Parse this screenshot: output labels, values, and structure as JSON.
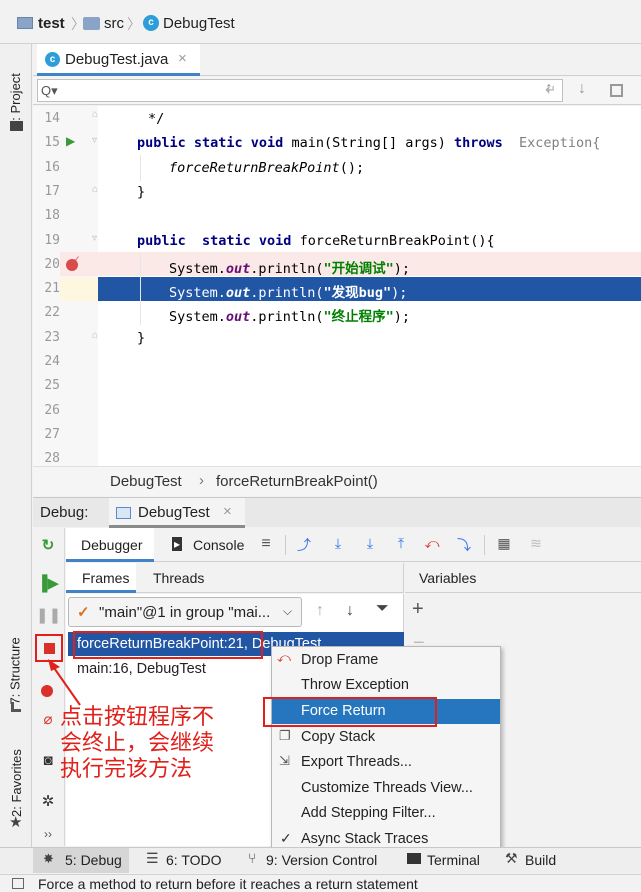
{
  "breadcrumb": {
    "project": "test",
    "folder": "src",
    "file": "DebugTest"
  },
  "editor_tab": {
    "label": "DebugTest.java",
    "close": "×"
  },
  "search": {
    "placeholder": "Q▾"
  },
  "left_strip": {
    "project": "1: Project",
    "structure": "7: Structure",
    "favorites": "2: Favorites"
  },
  "lines": [
    {
      "n": "14"
    },
    {
      "n": "15"
    },
    {
      "n": "16"
    },
    {
      "n": "17"
    },
    {
      "n": "18"
    },
    {
      "n": "19"
    },
    {
      "n": "20"
    },
    {
      "n": "21"
    },
    {
      "n": "22"
    },
    {
      "n": "23"
    },
    {
      "n": "24"
    },
    {
      "n": "25"
    },
    {
      "n": "26"
    },
    {
      "n": "27"
    },
    {
      "n": "28"
    }
  ],
  "code": {
    "l14": "*/",
    "l15_kw": "public static void",
    "l15_name": " main(String[] args) ",
    "l15_throws": "throws",
    "l15_exc": " Exception{",
    "l16": "forceReturnBreakPoint",
    "l16_end": "();",
    "l17": "}",
    "l19_kw": "public  static void",
    "l19_rest": " forceReturnBreakPoint(){",
    "sys": "System.",
    "out": "out",
    "println": ".println(",
    "s20": "\"开始调试\"",
    "s21": "\"发现bug\"",
    "s22": "\"终止程序\"",
    "end": ");",
    "l23": "}"
  },
  "editor_breadcrumb": {
    "cls": "DebugTest",
    "sep": "›",
    "method": "forceReturnBreakPoint()"
  },
  "debug": {
    "label": "Debug:",
    "config": "DebugTest",
    "close": "×"
  },
  "debug_tabs": {
    "debugger": "Debugger",
    "console": "Console"
  },
  "panels": {
    "frames": "Frames",
    "threads": "Threads",
    "variables": "Variables"
  },
  "thread_select": "\"main\"@1 in group \"mai...",
  "frames": [
    {
      "label": "forceReturnBreakPoint:21, DebugTest"
    },
    {
      "label": "main:16, DebugTest"
    }
  ],
  "context_menu": [
    {
      "label": "Drop Frame"
    },
    {
      "label": "Throw Exception"
    },
    {
      "label": "Force Return"
    },
    {
      "label": "Copy Stack"
    },
    {
      "label": "Export Threads..."
    },
    {
      "label": "Customize Threads View..."
    },
    {
      "label": "Add Stepping Filter..."
    },
    {
      "label": "Async Stack Traces"
    }
  ],
  "annotation": {
    "line1": "点击按钮程序不",
    "line2": "会终止，会继续",
    "line3": "执行完该方法"
  },
  "bottom_tabs": [
    {
      "label": "5: Debug"
    },
    {
      "label": "6: TODO"
    },
    {
      "label": "9: Version Control"
    },
    {
      "label": "Terminal"
    },
    {
      "label": "Build"
    }
  ],
  "status": "Force a method to return before it reaches a return statement",
  "colors": {
    "selection": "#2156a5",
    "breakpoint_line": "#fae9e6",
    "menu_selected": "#2675bf",
    "annotation_red": "#e0201a"
  }
}
